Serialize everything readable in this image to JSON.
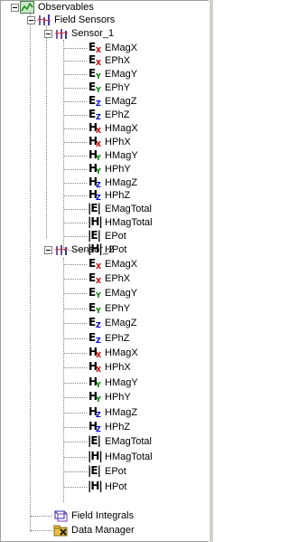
{
  "tree": {
    "root": {
      "label": "Observables",
      "icon": "chart-icon"
    },
    "field_sensors": {
      "label": "Field Sensors",
      "icon": "sensors-icon"
    },
    "sensors": [
      {
        "label": "Sensor_1",
        "icon": "sensor-icon",
        "items": [
          {
            "label": "EMagX",
            "glyph": "E",
            "sub": "X",
            "sub_color": "#cc0000"
          },
          {
            "label": "EPhX",
            "glyph": "E",
            "sub": "X",
            "sub_color": "#cc0000"
          },
          {
            "label": "EMagY",
            "glyph": "E",
            "sub": "Y",
            "sub_color": "#008000"
          },
          {
            "label": "EPhY",
            "glyph": "E",
            "sub": "Y",
            "sub_color": "#008000"
          },
          {
            "label": "EMagZ",
            "glyph": "E",
            "sub": "Z",
            "sub_color": "#0000cc"
          },
          {
            "label": "EPhZ",
            "glyph": "E",
            "sub": "Z",
            "sub_color": "#0000cc"
          },
          {
            "label": "HMagX",
            "glyph": "H",
            "sub": "X",
            "sub_color": "#cc0000"
          },
          {
            "label": "HPhX",
            "glyph": "H",
            "sub": "X",
            "sub_color": "#cc0000"
          },
          {
            "label": "HMagY",
            "glyph": "H",
            "sub": "Y",
            "sub_color": "#008000"
          },
          {
            "label": "HPhY",
            "glyph": "H",
            "sub": "Y",
            "sub_color": "#008000"
          },
          {
            "label": "HMagZ",
            "glyph": "H",
            "sub": "Z",
            "sub_color": "#0000cc"
          },
          {
            "label": "HPhZ",
            "glyph": "H",
            "sub": "Z",
            "sub_color": "#0000cc"
          },
          {
            "label": "EMagTotal",
            "glyph": "|E|",
            "sub": "",
            "sub_color": "#000000"
          },
          {
            "label": "HMagTotal",
            "glyph": "|H|",
            "sub": "",
            "sub_color": "#000000"
          },
          {
            "label": "EPot",
            "glyph": "|E|",
            "sub": "",
            "sub_color": "#000000"
          },
          {
            "label": "HPot",
            "glyph": "|H|",
            "sub": "",
            "sub_color": "#000000"
          }
        ]
      },
      {
        "label": "Sensor_2",
        "icon": "sensor-icon",
        "items": [
          {
            "label": "EMagX",
            "glyph": "E",
            "sub": "X",
            "sub_color": "#cc0000"
          },
          {
            "label": "EPhX",
            "glyph": "E",
            "sub": "X",
            "sub_color": "#cc0000"
          },
          {
            "label": "EMagY",
            "glyph": "E",
            "sub": "Y",
            "sub_color": "#008000"
          },
          {
            "label": "EPhY",
            "glyph": "E",
            "sub": "Y",
            "sub_color": "#008000"
          },
          {
            "label": "EMagZ",
            "glyph": "E",
            "sub": "Z",
            "sub_color": "#0000cc"
          },
          {
            "label": "EPhZ",
            "glyph": "E",
            "sub": "Z",
            "sub_color": "#0000cc"
          },
          {
            "label": "HMagX",
            "glyph": "H",
            "sub": "X",
            "sub_color": "#cc0000"
          },
          {
            "label": "HPhX",
            "glyph": "H",
            "sub": "X",
            "sub_color": "#cc0000"
          },
          {
            "label": "HMagY",
            "glyph": "H",
            "sub": "Y",
            "sub_color": "#008000"
          },
          {
            "label": "HPhY",
            "glyph": "H",
            "sub": "Y",
            "sub_color": "#008000"
          },
          {
            "label": "HMagZ",
            "glyph": "H",
            "sub": "Z",
            "sub_color": "#0000cc"
          },
          {
            "label": "HPhZ",
            "glyph": "H",
            "sub": "Z",
            "sub_color": "#0000cc"
          },
          {
            "label": "EMagTotal",
            "glyph": "|E|",
            "sub": "",
            "sub_color": "#000000"
          },
          {
            "label": "HMagTotal",
            "glyph": "|H|",
            "sub": "",
            "sub_color": "#000000"
          },
          {
            "label": "EPot",
            "glyph": "|E|",
            "sub": "",
            "sub_color": "#000000"
          },
          {
            "label": "HPot",
            "glyph": "|H|",
            "sub": "",
            "sub_color": "#000000"
          }
        ]
      }
    ],
    "field_integrals": {
      "label": "Field Integrals",
      "icon": "integrals-icon"
    },
    "data_manager": {
      "label": "Data Manager",
      "icon": "data-manager-icon"
    }
  }
}
